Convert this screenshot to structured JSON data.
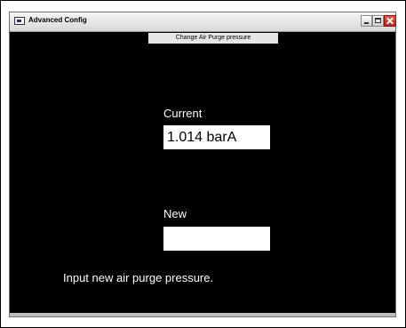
{
  "window": {
    "title": "Advanced Config",
    "header": "Change Air Purge pressure"
  },
  "form": {
    "current_label": "Current",
    "current_value": "1.014 barA",
    "new_label": "New",
    "new_value": "",
    "hint": "Input new air purge pressure."
  },
  "icons": [
    "app-icon",
    "minimize-icon",
    "maximize-icon",
    "close-icon"
  ]
}
